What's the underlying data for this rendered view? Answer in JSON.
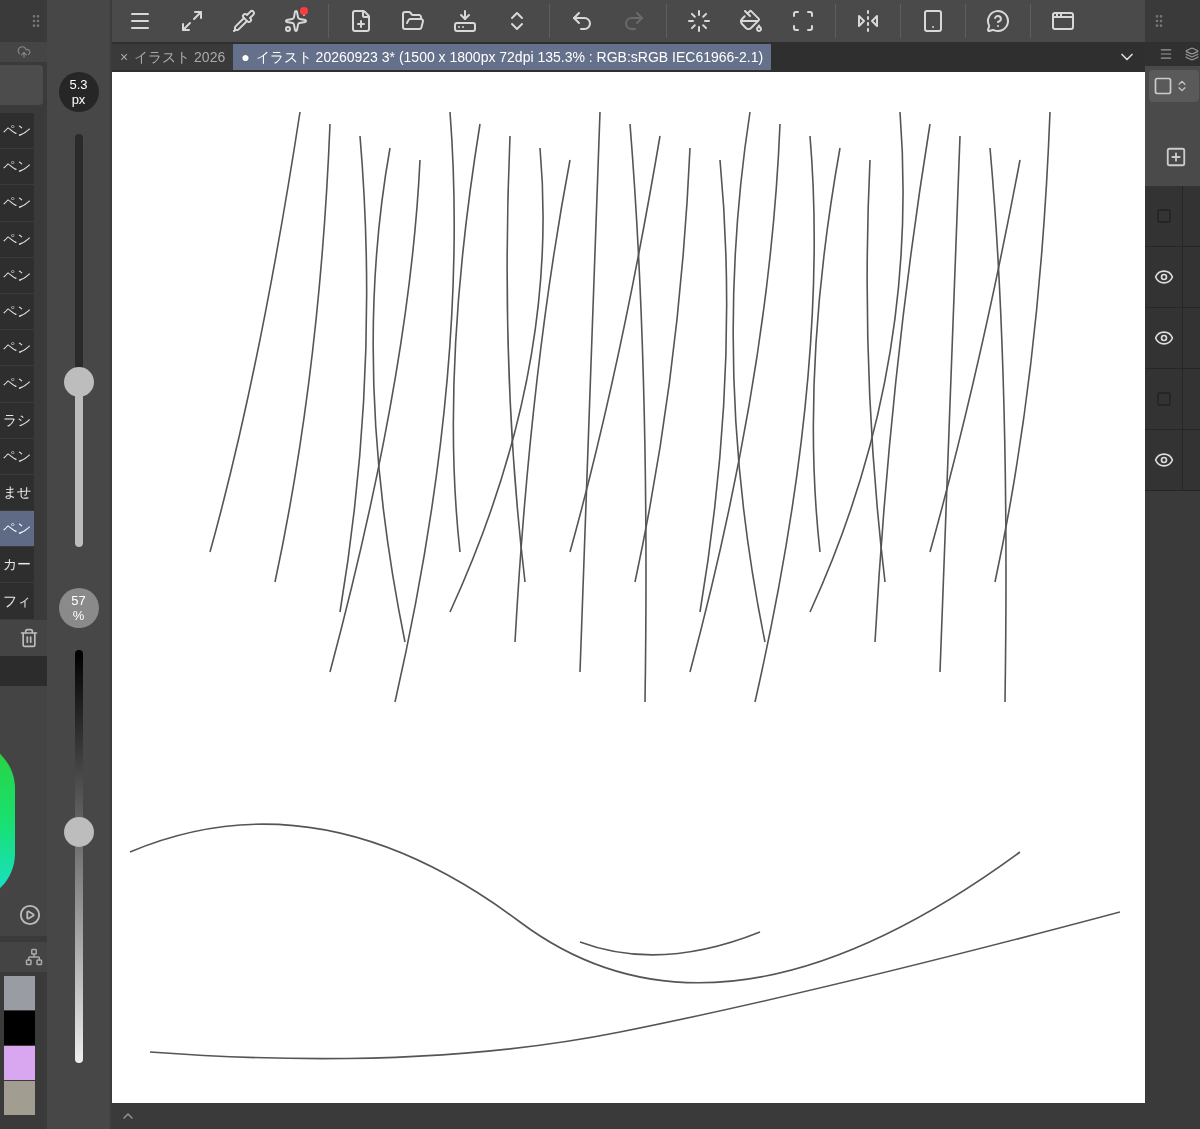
{
  "toolbar": [
    {
      "disabled": false,
      "notification": false
    },
    {
      "disabled": false,
      "notification": false
    },
    {
      "disabled": false,
      "notification": false
    },
    {
      "disabled": false,
      "notification": true
    },
    {
      "disabled": false,
      "notification": false
    },
    {
      "disabled": false,
      "notification": false
    },
    {
      "disabled": false,
      "notification": false
    },
    {
      "disabled": false,
      "notification": false
    },
    {
      "disabled": false,
      "notification": false
    },
    {
      "disabled": true,
      "notification": false
    },
    {
      "disabled": false,
      "notification": false
    },
    {
      "disabled": false,
      "notification": false
    },
    {
      "disabled": false,
      "notification": false
    },
    {
      "disabled": false,
      "notification": false
    },
    {
      "disabled": false,
      "notification": false
    },
    {
      "disabled": false,
      "notification": false
    },
    {
      "disabled": false,
      "notification": false
    }
  ],
  "tabs": [
    {
      "marker": "×",
      "label": "イラスト 2026",
      "selected": false
    },
    {
      "marker": "●",
      "label": "イラスト 20260923 3* (1500 x 1800px 72dpi 135.3% : RGB:sRGB IEC61966-2.1)",
      "selected": true
    }
  ],
  "tools": [
    {
      "label": "ペン",
      "selected": false
    },
    {
      "label": "ペン",
      "selected": false
    },
    {
      "label": "ペン",
      "selected": false
    },
    {
      "label": "ペン",
      "selected": false
    },
    {
      "label": "ペン",
      "selected": false
    },
    {
      "label": "ペン",
      "selected": false
    },
    {
      "label": "ペン",
      "selected": false
    },
    {
      "label": "ペン",
      "selected": false
    },
    {
      "label": "ラシ",
      "selected": false
    },
    {
      "label": "ペン",
      "selected": false
    },
    {
      "label": "ませ",
      "selected": false
    },
    {
      "label": "ペン",
      "selected": true
    },
    {
      "label": "カー",
      "selected": false
    },
    {
      "label": "フィ",
      "selected": false
    }
  ],
  "brush_size": {
    "value": "5.3",
    "unit": "px",
    "level": 0.4
  },
  "opacity": {
    "value": "57",
    "unit": "%",
    "level": 0.56
  },
  "swatches": [
    {
      "color": "#9a9ca3"
    },
    {
      "color": "#000000"
    },
    {
      "color": "#d9a6f0"
    },
    {
      "color": "#a19d90"
    }
  ],
  "layers": [
    {
      "visible": false
    },
    {
      "visible": true
    },
    {
      "visible": true
    },
    {
      "visible": false
    },
    {
      "visible": true
    }
  ]
}
